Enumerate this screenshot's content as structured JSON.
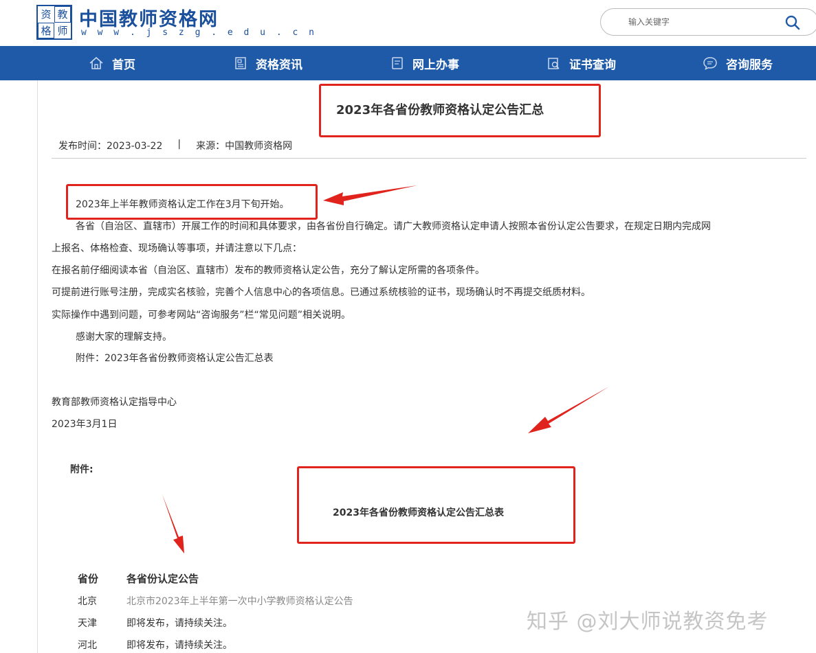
{
  "header": {
    "logo_chars": [
      "资",
      "教",
      "格",
      "师"
    ],
    "site_title": "中国教师资格网",
    "site_url": "w w w . j s z g . e d u . c n",
    "search": {
      "placeholder": "输入关键字"
    }
  },
  "nav": {
    "items": [
      {
        "label": "首页",
        "icon": "home-icon"
      },
      {
        "label": "资格资讯",
        "icon": "news-icon"
      },
      {
        "label": "网上办事",
        "icon": "document-icon"
      },
      {
        "label": "证书查询",
        "icon": "certificate-search-icon"
      },
      {
        "label": "咨询服务",
        "icon": "chat-icon"
      }
    ]
  },
  "article": {
    "title": "2023年各省份教师资格认定公告汇总",
    "publish_label": "发布时间：2023-03-22",
    "separator": "|",
    "source_label": "来源：中国教师资格网",
    "paragraphs": [
      "2023年上半年教师资格认定工作在3月下旬开始。",
      "各省（自治区、直辖市）开展工作的时间和具体要求，由各省份自行确定。请广大教师资格认定申请人按照本省份认定公告要求，在规定日期内完成网",
      "上报名、体格检查、现场确认等事项，并请注意以下几点：",
      "在报名前仔细阅读本省（自治区、直辖市）发布的教师资格认定公告，充分了解认定所需的各项条件。",
      "可提前进行账号注册，完成实名核验，完善个人信息中心的各项信息。已通过系统核验的证书，现场确认时不再提交纸质材料。",
      "实际操作中遇到问题，可参考网站“咨询服务”栏“常见问题”相关说明。",
      "感谢大家的理解支持。",
      "附件：2023年各省份教师资格认定公告汇总表"
    ],
    "signature_org": "教育部教师资格认定指导中心",
    "signature_date": "2023年3月1日"
  },
  "attachment": {
    "label": "附件:",
    "table_title": "2023年各省份教师资格认定公告汇总表",
    "columns": [
      "省份",
      "各省份认定公告"
    ],
    "rows": [
      {
        "province": "北京",
        "notice": "北京市2023年上半年第一次中小学教师资格认定公告"
      },
      {
        "province": "天津",
        "notice": "即将发布，请持续关注。"
      },
      {
        "province": "河北",
        "notice": "即将发布，请持续关注。"
      }
    ]
  },
  "watermark": "知乎 @刘大师说教资免考",
  "colors": {
    "brand_blue": "#1e5aa8",
    "annotation_red": "#e0231c"
  }
}
